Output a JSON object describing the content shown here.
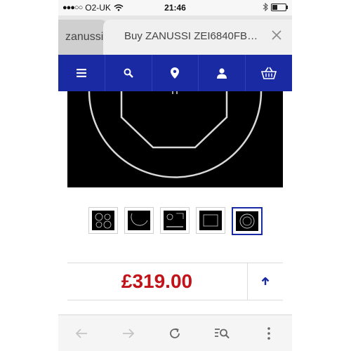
{
  "status_bar": {
    "carrier": "O2-UK",
    "time": "21:46"
  },
  "tabs": {
    "previous_label": "zanussi",
    "active_title": "Buy ZANUSSI ZEI6840FB…"
  },
  "nav": {
    "items": [
      "menu-icon",
      "search-icon",
      "location-pin-icon",
      "user-icon",
      "basket-icon"
    ]
  },
  "product": {
    "price": "£319.00"
  },
  "thumbnails": {
    "count": 5,
    "selected_index": 4
  },
  "toolbar": {
    "items": [
      "back-arrow-icon",
      "forward-arrow-icon",
      "reload-icon",
      "find-icon",
      "more-icon"
    ]
  },
  "colors": {
    "brand_nav": "#1a2aa3",
    "price": "#c0141a"
  }
}
